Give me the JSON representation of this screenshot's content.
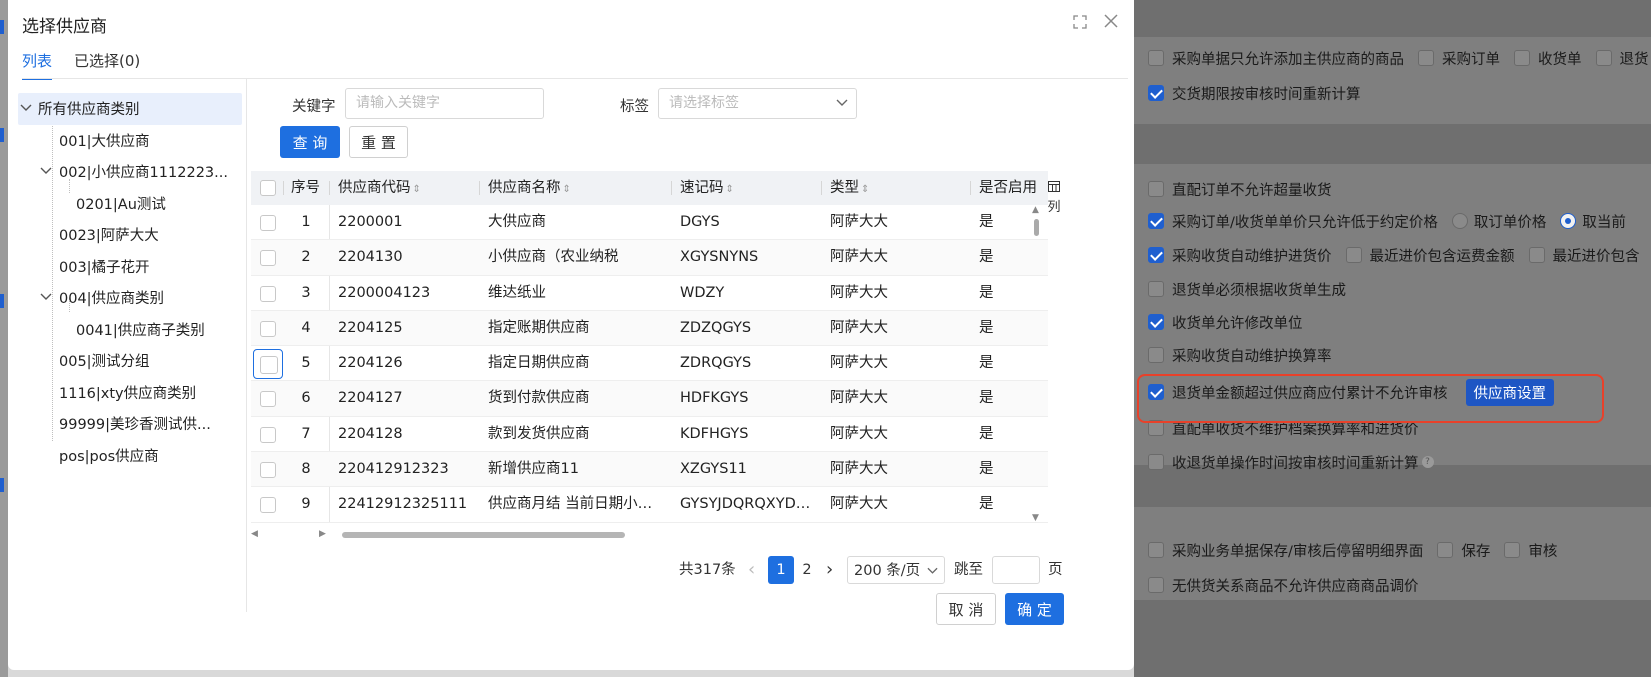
{
  "modal": {
    "title": "选择供应商",
    "tabs": [
      {
        "label": "列表",
        "active": true
      },
      {
        "label": "已选择(0)",
        "active": false
      }
    ]
  },
  "tree": {
    "items": [
      {
        "label": "所有供应商类别",
        "level": 0,
        "expanded": true,
        "selected": true
      },
      {
        "label": "001|大供应商",
        "level": 1
      },
      {
        "label": "002|小供应商1112223...",
        "level": 1,
        "expanded": true
      },
      {
        "label": "0201|Au测试",
        "level": 2
      },
      {
        "label": "0023|阿萨大大",
        "level": 1
      },
      {
        "label": "003|橘子花开",
        "level": 1
      },
      {
        "label": "004|供应商类别",
        "level": 1,
        "expanded": true
      },
      {
        "label": "0041|供应商子类别",
        "level": 2
      },
      {
        "label": "005|测试分组",
        "level": 1
      },
      {
        "label": "1116|xty供应商类别",
        "level": 1
      },
      {
        "label": "99999|美珍香测试供...",
        "level": 1
      },
      {
        "label": "pos|pos供应商",
        "level": 1
      }
    ]
  },
  "filters": {
    "keyword_label": "关键字",
    "keyword_placeholder": "请输入关键字",
    "tag_label": "标签",
    "tag_placeholder": "请选择标签",
    "query_button": "查 询",
    "reset_button": "重 置"
  },
  "table": {
    "columns": [
      "序号",
      "供应商代码",
      "供应商名称",
      "速记码",
      "类型",
      "是否启用"
    ],
    "column_settings_label": "列",
    "rows": [
      {
        "no": "1",
        "code": "2200001",
        "name": "大供应商",
        "shortcode": "DGYS",
        "type": "阿萨大大",
        "enabled": "是"
      },
      {
        "no": "2",
        "code": "2204130",
        "name": "小供应商（农业纳税",
        "shortcode": "XGYSNYNS",
        "type": "阿萨大大",
        "enabled": "是"
      },
      {
        "no": "3",
        "code": "2200004123",
        "name": "维达纸业",
        "shortcode": "WDZY",
        "type": "阿萨大大",
        "enabled": "是"
      },
      {
        "no": "4",
        "code": "2204125",
        "name": "指定账期供应商",
        "shortcode": "ZDZQGYS",
        "type": "阿萨大大",
        "enabled": "是"
      },
      {
        "no": "5",
        "code": "2204126",
        "name": "指定日期供应商",
        "shortcode": "ZDRQGYS",
        "type": "阿萨大大",
        "enabled": "是"
      },
      {
        "no": "6",
        "code": "2204127",
        "name": "货到付款供应商",
        "shortcode": "HDFKGYS",
        "type": "阿萨大大",
        "enabled": "是"
      },
      {
        "no": "7",
        "code": "2204128",
        "name": "款到发货供应商",
        "shortcode": "KDFHGYS",
        "type": "阿萨大大",
        "enabled": "是"
      },
      {
        "no": "8",
        "code": "220412912323",
        "name": "新增供应商11",
        "shortcode": "XZGYS11",
        "type": "阿萨大大",
        "enabled": "是"
      },
      {
        "no": "9",
        "code": "22412912325111",
        "name": "供应商月结 当前日期小…",
        "shortcode": "GYSYJDQRQXYD…",
        "type": "阿萨大大",
        "enabled": "是"
      }
    ]
  },
  "pagination": {
    "total": "共317条",
    "prev": "‹",
    "pages": [
      "1",
      "2"
    ],
    "active_page": "1",
    "next": "›",
    "page_size": "200 条/页",
    "jump_label": "跳至",
    "page_unit": "页"
  },
  "footer": {
    "cancel_button": "取 消",
    "ok_button": "确 定"
  },
  "background": {
    "row1": {
      "label": "采购单据只允许添加主供应商的商品",
      "opts": [
        "采购订单",
        "收货单",
        "退货"
      ]
    },
    "row2": "交货期限按审核时间重新计算",
    "row3": "直配订单不允许超量收货",
    "row4": {
      "label": "采购订单/收货单单价只允许低于约定价格",
      "radio1": "取订单价格",
      "radio2": "取当前"
    },
    "row5": {
      "label": "采购收货自动维护进货价",
      "opt1": "最近进价包含运费金额",
      "opt2": "最近进价包含"
    },
    "row6": "退货单必须根据收货单生成",
    "row7": "收货单允许修改单位",
    "row8": "采购收货自动维护换算率",
    "row9": {
      "label": "退货单金额超过供应商应付累计不允许审核",
      "button": "供应商设置"
    },
    "row10": "直配单收货不维护档案换算率和进货价",
    "row11": "收退货单操作时间按审核时间重新计算",
    "row12": {
      "label": "采购业务单据保存/审核后停留明细界面",
      "opt1": "保存",
      "opt2": "审核"
    },
    "row13": "无供货关系商品不允许供应商商品调价"
  },
  "colors": {
    "primary": "#1e6fe0",
    "highlight": "#e8412a",
    "overlay": "#7f7f7f"
  },
  "icons": [
    "maximize-icon",
    "close-icon",
    "caret-down-icon",
    "sort-icon",
    "column-settings-icon",
    "chevron-left-icon",
    "chevron-right-icon",
    "help-icon"
  ]
}
